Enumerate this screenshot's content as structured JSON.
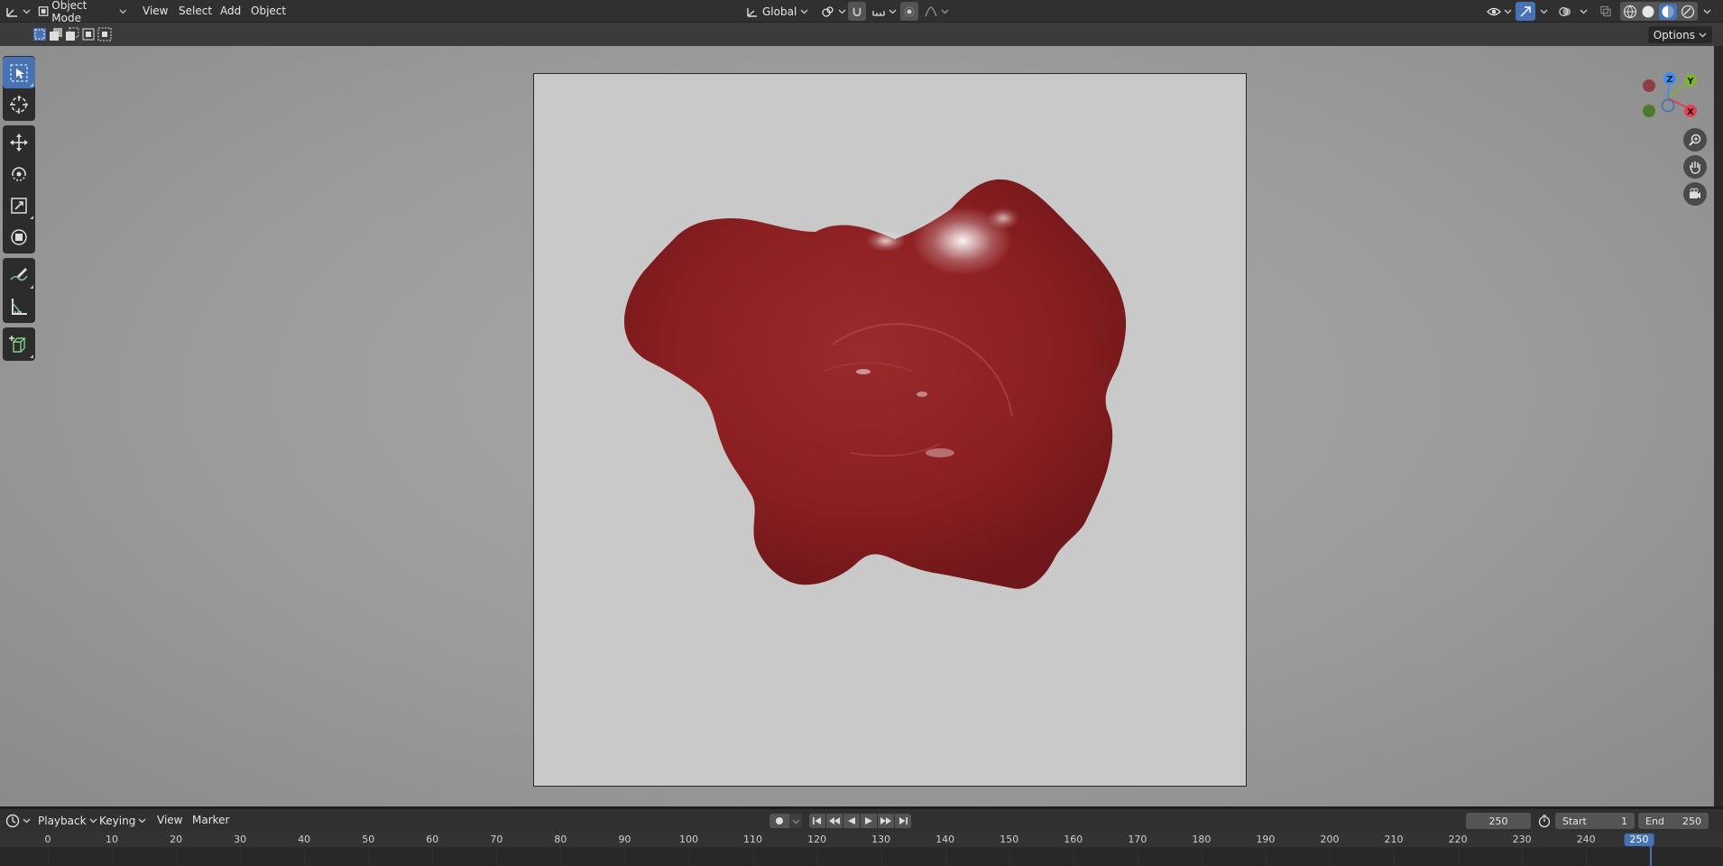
{
  "header": {
    "mode_label": "Object Mode",
    "menus": [
      "View",
      "Select",
      "Add",
      "Object"
    ],
    "orientation_label": "Global"
  },
  "subheader": {
    "options_label": "Options"
  },
  "viewport": {
    "gizmo_axes": {
      "x": "X",
      "y": "Y",
      "z": "Z"
    },
    "object_color": "#8c1f22",
    "background_color": "#c9c9c9"
  },
  "timeline": {
    "menus": [
      "Playback",
      "Keying",
      "View",
      "Marker"
    ],
    "current_frame": "250",
    "start_label": "Start",
    "start_value": "1",
    "end_label": "End",
    "end_value": "250",
    "ruler_labels": [
      "0",
      "10",
      "20",
      "30",
      "40",
      "50",
      "60",
      "70",
      "80",
      "90",
      "100",
      "110",
      "120",
      "130",
      "140",
      "150",
      "160",
      "170",
      "180",
      "190",
      "200",
      "210",
      "220",
      "230",
      "240"
    ],
    "playhead_label": "250"
  },
  "colors": {
    "accent": "#4772b3",
    "axis_x": "#e0414c",
    "axis_y": "#7fb236",
    "axis_z": "#3c8ff0"
  }
}
